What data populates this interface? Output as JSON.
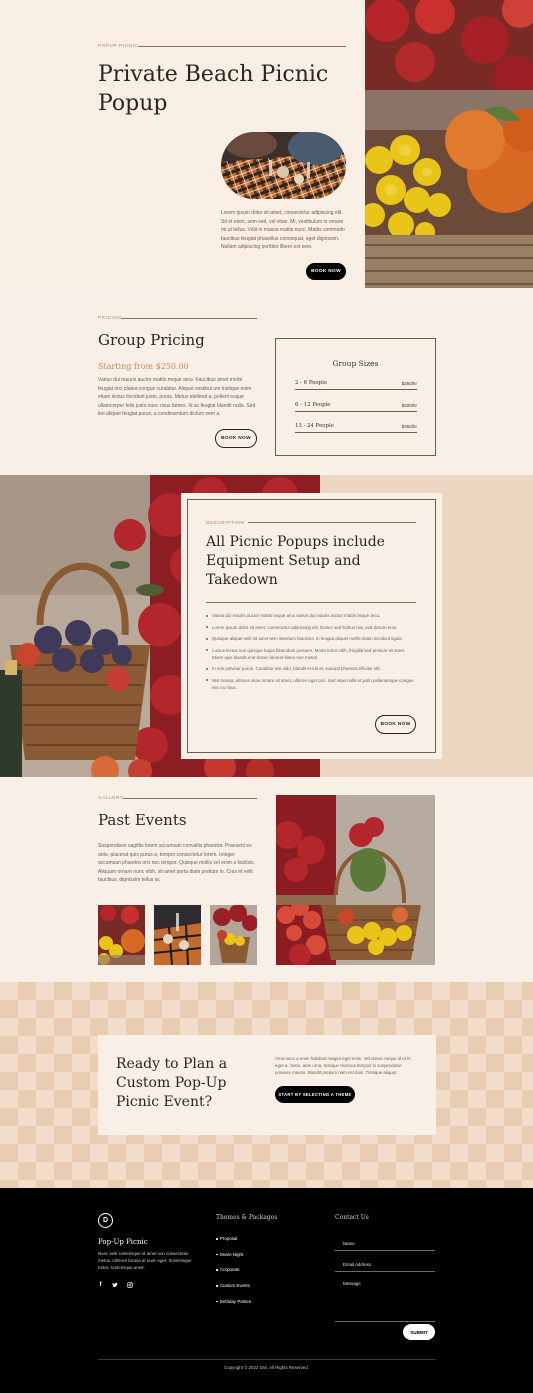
{
  "hero": {
    "eyebrow": "POPUP PICNIC",
    "title": "Private Beach Picnic Popup",
    "body": "Lorem ipsum dolor sit amet, consectetur adipiscing elit. Sit et enim, sem sed, vel vitae. Mi, vestibulum in ornare mi ut tellus. Velit in massa mattis nunc. Mattis commodo faucibus feugiat phasellus consequat, eget dignissim. Nullam adipiscing porttitor libero est sem.",
    "button": "BOOK NOW"
  },
  "pricing": {
    "eyebrow": "PRICING",
    "title": "Group Pricing",
    "price": "Starting from $250.00",
    "body": "Varius dui mauris auctor mattis neque arcu. Faucibus amet morbi feugiat orci platea congue curabitur. Aliquet vestibul um tristique enim etiam lectus tincidunt justo, purus. Metus eleifend a, pellent esque ullamcorper felis justo nunc risus fames. Id ac feugiat blandit nulla. Sed leo aliquet feugiat purus, a condimentum dictum sem a.",
    "button": "BOOK NOW",
    "card_title": "Group Sizes",
    "sizes": [
      {
        "label": "2 - 6 People",
        "price": "$250/hr"
      },
      {
        "label": "6 - 12 People",
        "price": "$320/hr"
      },
      {
        "label": "13 - 24 People",
        "price": "$450/hr"
      }
    ]
  },
  "description": {
    "eyebrow": "DESCRIPTION",
    "title": "All Picnic Popups include Equipment Setup and Takedown",
    "bullets": [
      "Varius dui mauris auctor mattis neque arcu varius dui mauris auctor mattis neque arcu.",
      "Lorem ipsum dolor sit amet, consectetur adipiscing elit. Donec sed finibus nisi, sed dictum eros.",
      "Quisque aliquet velit sit amet sem interdum faucibus. In feugiat aliquet mollis etiam tincidunt ligula.",
      "Luctus lectus non quisque turpis bibendum posuere. Morbi tortor nibh, fringilla sed pretium sit amet. Etiam quis blandit erat donec laoreet libero non metus.",
      "In non pulvinar purus. Curabitur nisi odio, blandit et elit at, suscipit pharetra efficitur elit.",
      "Nisl massa, ultrices vitae ornare sit amet, ultrices eget orci. Sed vitae nulla et justo pellentesque congue nec eu risus."
    ],
    "button": "BOOK NOW"
  },
  "gallery": {
    "eyebrow": "GALLERY",
    "title": "Past Events",
    "body": "Suspendisse sagittis lorem accumsan convallis pharetra. Praesent ex ante, placerat quis purus a, tempor consectetur lorem. Integer accumsan pharetra orci nec tempor. Quisque mollis vel enim a facilisis. Aliquam ornare nunc nibh, sit amet porta diam pretium in. Cras et velit faucibus, dignissim tellus at."
  },
  "cta": {
    "title": "Ready to Plan a Custom Pop-Up Picnic Event?",
    "body": "Arna nunc a enim habitant magna eget enim. Vel donec neque id et in eget a. Justo, ante urna, tristique rhoncus tempus in suspendisse posuere mauris. Blandit pretium nam est duis. Tristique aliquet.",
    "button": "START BY SELECTING A THEME"
  },
  "footer": {
    "logo_letter": "D",
    "brand": "Pop-Up Picnic",
    "brand_text": "Nunc velit scelerisque id amet non consectetur metus. Ultrices lacinia at nunc eget. Scelerisque tortor, scelerisque amet.",
    "themes_heading": "Themes & Packages",
    "themes": [
      "Proposal",
      "Movie Night",
      "Corporate",
      "Custom Events",
      "Birthday Parties"
    ],
    "contact_heading": "Contact Us",
    "name_label": "Name",
    "email_label": "Email Address",
    "message_label": "Message",
    "submit": "SUBMIT",
    "copyright": "Copyright © 2022 Divi. All Rights Reserved."
  },
  "icons": {
    "social": [
      "facebook-icon",
      "twitter-icon",
      "instagram-icon"
    ]
  }
}
